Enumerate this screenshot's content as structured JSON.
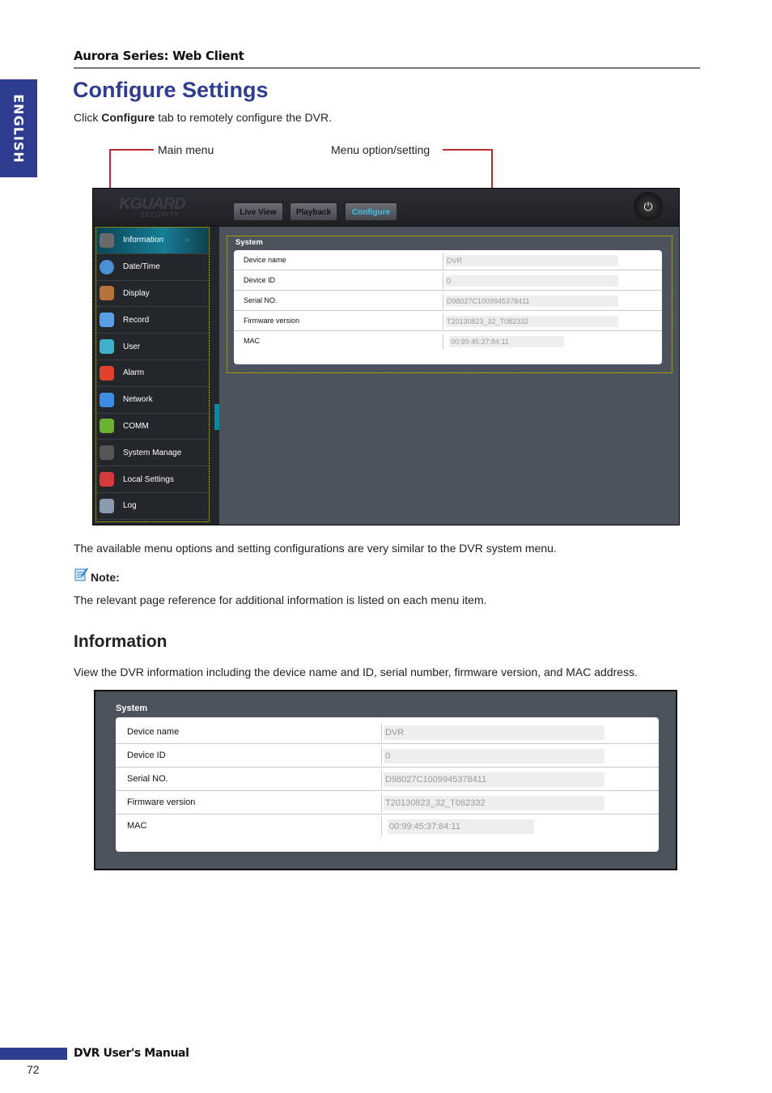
{
  "side_tab": "ENGLISH",
  "running_head": "Aurora Series: Web Client",
  "title": "Configure Settings",
  "intro": {
    "pre": "Click ",
    "bold": "Configure",
    "post": " tab to remotely configure the DVR."
  },
  "callouts": {
    "main_menu": "Main menu",
    "menu_option": "Menu option/setting"
  },
  "dvr_ui": {
    "logo": "GUARD",
    "logo_sub": "SECURITY",
    "tabs": [
      {
        "label": "Live View",
        "active": false
      },
      {
        "label": "Playback",
        "active": false
      },
      {
        "label": "Configure",
        "active": true
      }
    ],
    "accent_color": "#39c3ee",
    "menu": [
      {
        "label": "Information",
        "icon": "gear-icon",
        "active": true
      },
      {
        "label": "Date/Time",
        "icon": "clock-icon"
      },
      {
        "label": "Display",
        "icon": "monitor-icon"
      },
      {
        "label": "Record",
        "icon": "camera-icon"
      },
      {
        "label": "User",
        "icon": "users-icon"
      },
      {
        "label": "Alarm",
        "icon": "alarm-icon"
      },
      {
        "label": "Network",
        "icon": "network-icon"
      },
      {
        "label": "COMM",
        "icon": "at-icon"
      },
      {
        "label": "System Manage",
        "icon": "gears-icon"
      },
      {
        "label": "Local Settings",
        "icon": "local-settings-icon"
      },
      {
        "label": "Log",
        "icon": "calendar-icon"
      }
    ],
    "system": {
      "title": "System",
      "rows": [
        {
          "label": "Device name",
          "value": "DVR"
        },
        {
          "label": "Device ID",
          "value": "0"
        },
        {
          "label": "Serial NO.",
          "value": "D98027C1009945378411"
        },
        {
          "label": "Firmware version",
          "value": "T20130823_32_T082332"
        },
        {
          "label": "MAC",
          "value": "00:99:45:37:84:11"
        }
      ]
    }
  },
  "para_similar": "The available menu options and setting configurations are very similar to the DVR system menu.",
  "note_label": "Note:",
  "note_text": "The relevant page reference for additional information is listed on each menu item.",
  "section_title": "Information",
  "section_text": "View the DVR information including the device name and ID, serial number, firmware version, and MAC address.",
  "footer": {
    "title": "DVR User's Manual",
    "page": "72"
  }
}
